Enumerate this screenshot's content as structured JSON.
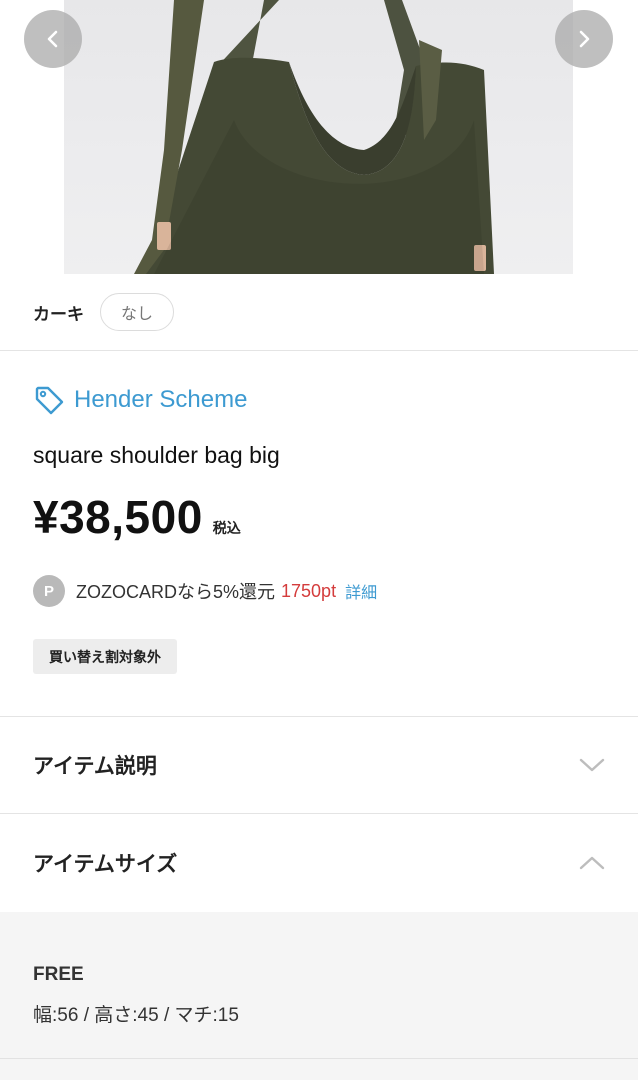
{
  "gallery": {
    "prev_icon": "chevron-left-icon",
    "next_icon": "chevron-right-icon",
    "photo_subject": "khaki canvas shoulder bag"
  },
  "color_selector": {
    "color_label": "カーキ",
    "stock_label": "なし"
  },
  "product": {
    "brand": "Hender Scheme",
    "brand_icon": "tag-icon",
    "name": "square shoulder bag big",
    "price": "¥38,500",
    "tax_label": "税込"
  },
  "points": {
    "badge": "P",
    "text": "ZOZOCARDなら5%還元",
    "value": "1750pt",
    "detail_link": "詳細"
  },
  "tag": "買い替え割対象外",
  "accordions": {
    "description_title": "アイテム説明",
    "size_title": "アイテムサイズ"
  },
  "size_info": {
    "size_name": "FREE",
    "dimensions": "幅:56 / 高さ:45 / マチ:15"
  },
  "colors": {
    "accent_blue": "#3d9ad1",
    "points_red": "#d43c3c",
    "bag_khaki": "#454a38"
  }
}
